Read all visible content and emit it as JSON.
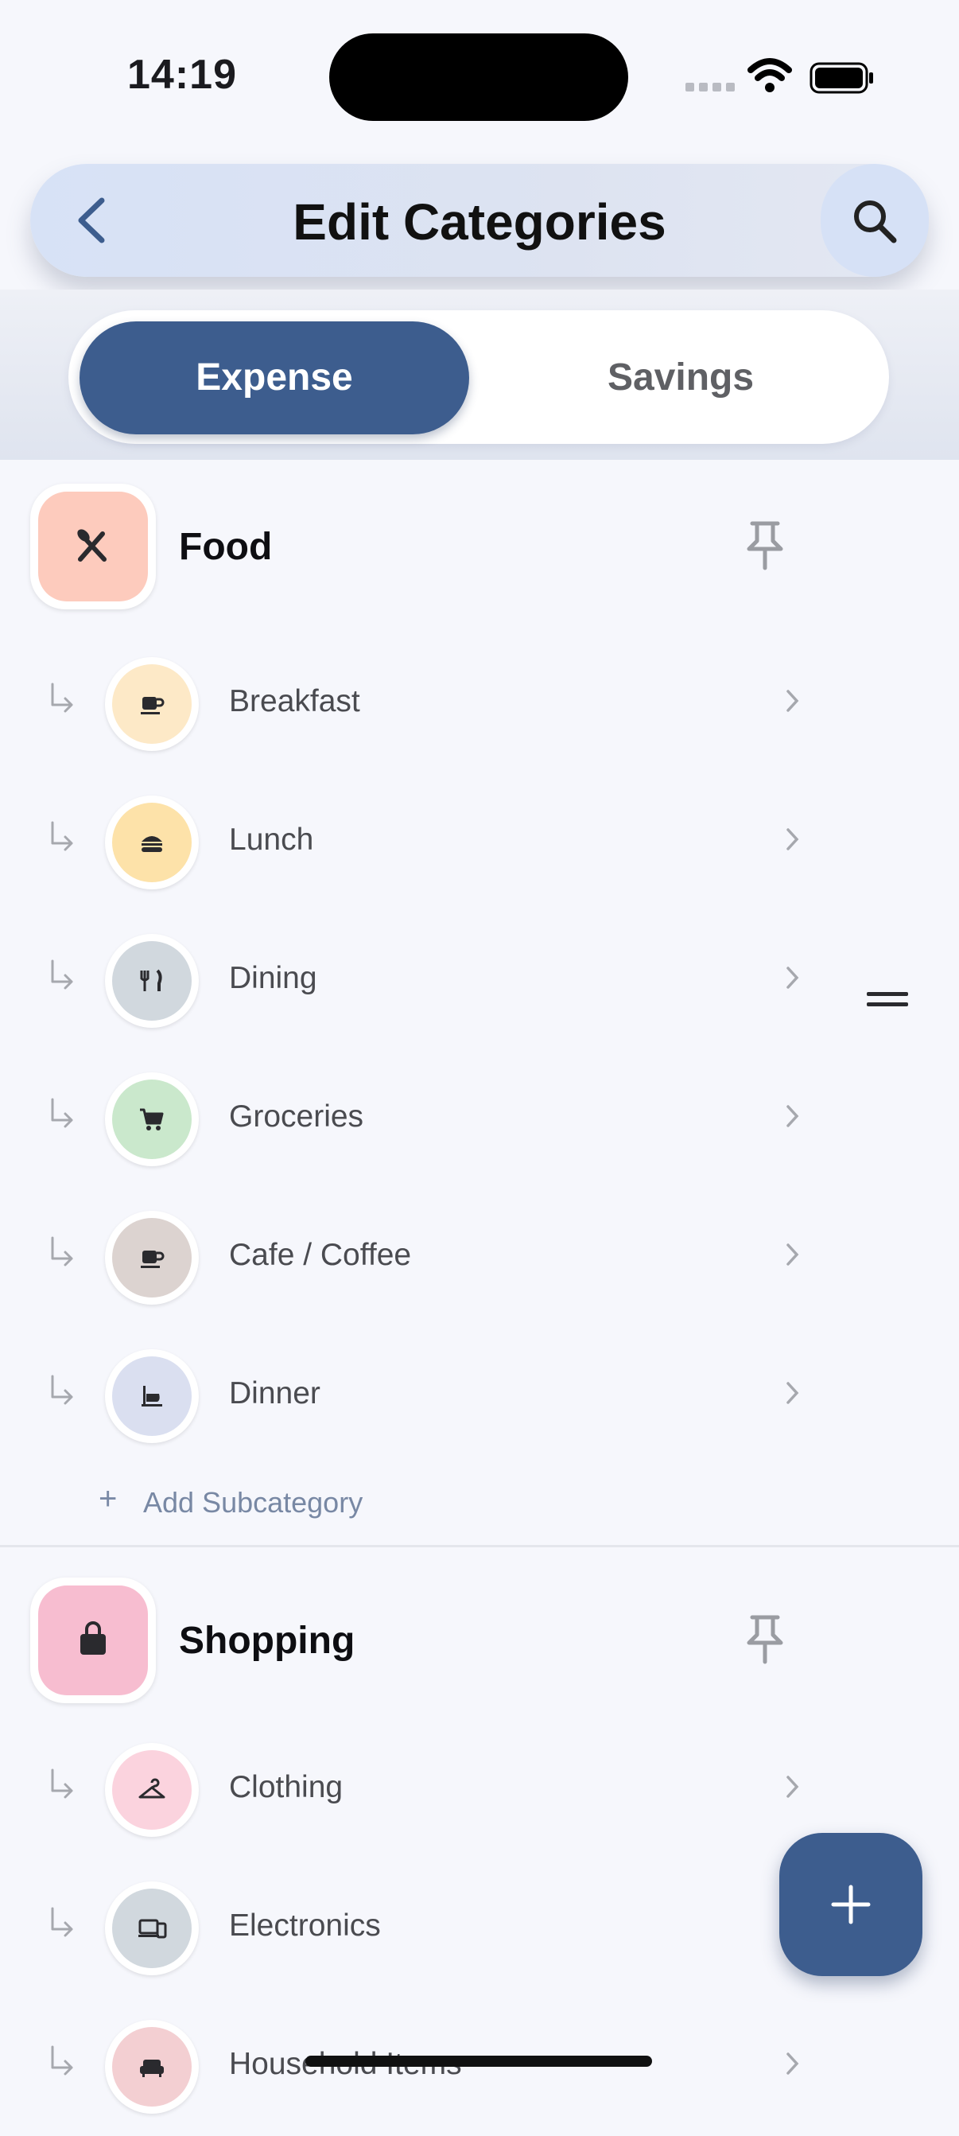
{
  "status": {
    "time": "14:19"
  },
  "header": {
    "title": "Edit Categories",
    "back_icon": "chevron-left-icon",
    "search_icon": "search-icon"
  },
  "tabs": [
    {
      "label": "Expense",
      "active": true
    },
    {
      "label": "Savings",
      "active": false
    }
  ],
  "colors": {
    "accent": "#3d5d8e",
    "background": "#f6f7fc"
  },
  "categories": [
    {
      "label": "Food",
      "icon": "utensils-icon",
      "color": "#fdcbbd",
      "subcategories": [
        {
          "label": "Breakfast",
          "icon": "coffee-cup-icon",
          "color": "#fde9c7"
        },
        {
          "label": "Lunch",
          "icon": "burger-icon",
          "color": "#fde2a9"
        },
        {
          "label": "Dining",
          "icon": "fork-knife-icon",
          "color": "#d1d8de"
        },
        {
          "label": "Groceries",
          "icon": "cart-icon",
          "color": "#cae8cc"
        },
        {
          "label": "Cafe / Coffee",
          "icon": "coffee-cup-icon",
          "color": "#dcd3d0"
        },
        {
          "label": "Dinner",
          "icon": "dinner-icon",
          "color": "#dadff0"
        }
      ],
      "add_label": "Add Subcategory"
    },
    {
      "label": "Shopping",
      "icon": "shopping-bag-icon",
      "color": "#f7bdd0",
      "subcategories": [
        {
          "label": "Clothing",
          "icon": "hanger-icon",
          "color": "#fbd3de"
        },
        {
          "label": "Electronics",
          "icon": "devices-icon",
          "color": "#d1d8de"
        },
        {
          "label": "Household Items",
          "icon": "sofa-icon",
          "color": "#f3cfd2"
        }
      ]
    }
  ],
  "fab": {
    "icon": "plus-icon"
  }
}
